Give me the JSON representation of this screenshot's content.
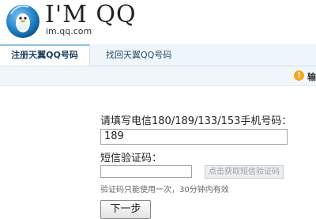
{
  "brand": {
    "name": "I'M QQ",
    "url": "im.qq.com",
    "icon": "qq-penguin-icon"
  },
  "tabs": [
    {
      "label": "注册天翼QQ号码",
      "active": true
    },
    {
      "label": "找回天翼QQ号码",
      "active": false
    }
  ],
  "notice": {
    "icon_text": "!",
    "text": "输"
  },
  "form": {
    "phone_label": "请填写电信180/189/133/153手机号码：",
    "phone_value": "189",
    "code_label": "短信验证码：",
    "code_value": "",
    "sms_button": "点击获取短信验证码",
    "hint": "验证码只能使用一次，30分钟内有效",
    "next_button": "下一步"
  },
  "colors": {
    "accent": "#1d3f5e",
    "notice": "#f5a623",
    "tab_bg": "#eef6fb"
  }
}
